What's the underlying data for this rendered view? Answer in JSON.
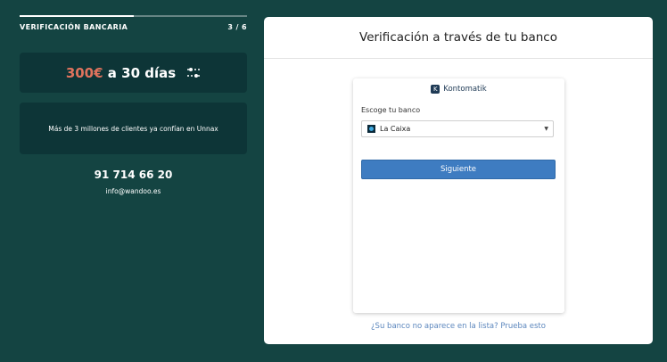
{
  "progress": {
    "step_title": "VERIFICACIÓN BANCARIA",
    "step_counter": "3 / 6",
    "fraction": 0.5
  },
  "offer": {
    "amount": "300€",
    "term": "a 30 días",
    "icon": "sliders-icon"
  },
  "trust": {
    "text": "Más de 3 millones de clientes ya confían en Unnax"
  },
  "contact": {
    "phone": "91 714 66 20",
    "email": "info@wandoo.es"
  },
  "panel": {
    "title": "Verificación a través de tu banco",
    "widget": {
      "brand": "Kontomatik",
      "bank_label": "Escoge tu banco",
      "selected_bank": "La Caixa",
      "next_label": "Siguiente"
    },
    "help_link": "¿Su banco no aparece en la lista? Prueba esto"
  },
  "colors": {
    "background": "#144442",
    "card": "#0d3537",
    "accent": "#e0735d",
    "button": "#3e7cc1",
    "link": "#5b86bd"
  }
}
